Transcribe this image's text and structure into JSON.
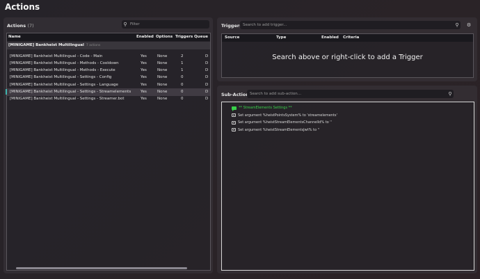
{
  "app": {
    "title": "Actions"
  },
  "actions_panel": {
    "title": "Actions",
    "count": "(7)",
    "filter_placeholder": "Filter",
    "columns": [
      "Name",
      "Enabled",
      "Options",
      "Triggers",
      "Queue"
    ],
    "group": {
      "name": "[MINIGAME] Bankheist Multilingual",
      "count": "7 actions"
    },
    "rows": [
      {
        "name": "[MINIGAME] Bankheist Multilingual - Code - Main",
        "enabled": "Yes",
        "options": "None",
        "triggers": "2",
        "queue": "D"
      },
      {
        "name": "[MINIGAME] Bankheist Multilingual - Methods - Cooldown",
        "enabled": "Yes",
        "options": "None",
        "triggers": "1",
        "queue": "D"
      },
      {
        "name": "[MINIGAME] Bankheist Multilingual - Methods - Execute",
        "enabled": "Yes",
        "options": "None",
        "triggers": "1",
        "queue": "D"
      },
      {
        "name": "[MINIGAME] Bankheist Multilingual - Settings - Config",
        "enabled": "Yes",
        "options": "None",
        "triggers": "0",
        "queue": "D"
      },
      {
        "name": "[MINIGAME] Bankheist Multilingual - Settings - Language",
        "enabled": "Yes",
        "options": "None",
        "triggers": "0",
        "queue": "D"
      },
      {
        "name": "[MINIGAME] Bankheist Multilingual - Settings - Streamelements",
        "enabled": "Yes",
        "options": "None",
        "triggers": "0",
        "queue": "D",
        "selected": true
      },
      {
        "name": "[MINIGAME] Bankheist Multilingual - Settings - Streamer.bot",
        "enabled": "Yes",
        "options": "None",
        "triggers": "0",
        "queue": "D"
      }
    ]
  },
  "triggers_panel": {
    "title": "Triggers",
    "search_placeholder": "Search to add trigger...",
    "columns": [
      "Source",
      "Type",
      "Enabled",
      "Criteria"
    ],
    "empty_message": "Search above or right-click to add a Trigger"
  },
  "subactions_panel": {
    "title": "Sub-Actions",
    "search_placeholder": "Search to add sub-action...",
    "items": [
      {
        "text": "** StreamElements Settings **",
        "kind": "group",
        "icon": "chat-icon"
      },
      {
        "text": "Set argument %heistPointsSystem% to 'streamelements'",
        "kind": "argument",
        "icon": "argument-icon"
      },
      {
        "text": "Set argument %heistStreamElementsChannelId% to ''",
        "kind": "argument",
        "icon": "argument-icon"
      },
      {
        "text": "Set argument %heistStreamElementsJwt% to ''",
        "kind": "argument",
        "icon": "argument-icon"
      }
    ]
  }
}
